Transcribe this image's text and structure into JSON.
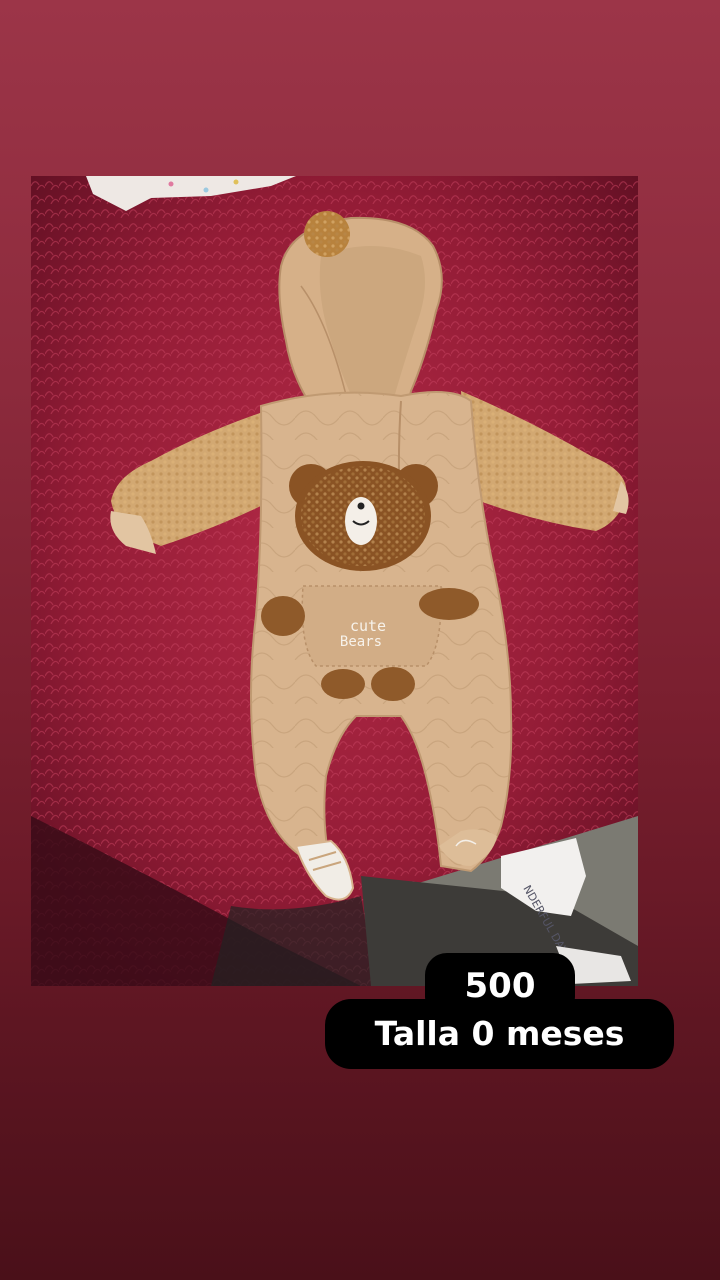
{
  "photo": {
    "subject": "baby-romper",
    "garment_text": [
      "cute",
      "Bears"
    ],
    "tag_text": "NDERFUL DAY"
  },
  "captions": {
    "price": "500",
    "size": "Talla 0 meses"
  },
  "colors": {
    "background_top": "#9c3548",
    "background_bottom": "#4a1019",
    "caption_bg": "#000000",
    "caption_text": "#ffffff",
    "rug": "#8e1a33",
    "romper": "#d8b48e",
    "sherpa": "#c89a5e",
    "bear_patch": "#8a5324"
  }
}
